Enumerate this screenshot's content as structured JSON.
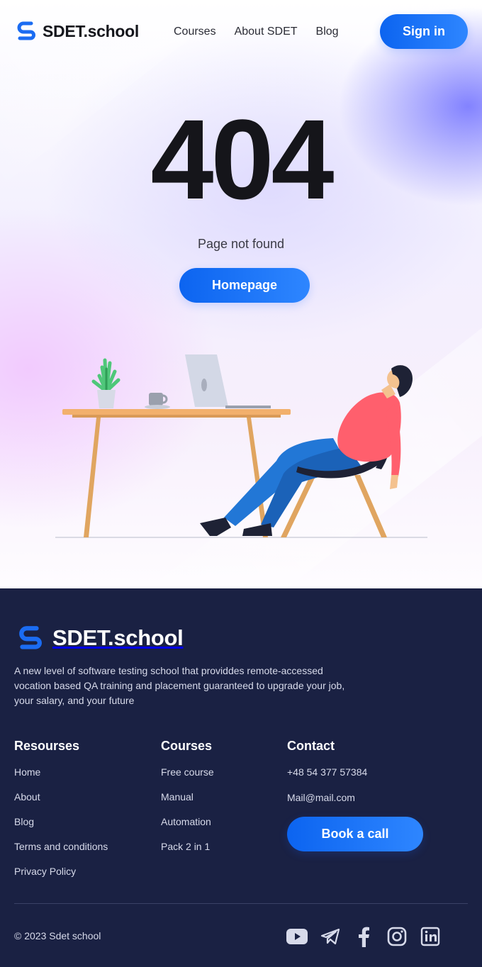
{
  "header": {
    "logo_text": "SDET.school",
    "nav": [
      "Courses",
      "About SDET",
      "Blog"
    ],
    "sign_in": "Sign in"
  },
  "hero": {
    "code": "404",
    "message": "Page not found",
    "button": "Homepage"
  },
  "footer": {
    "logo_text": "SDET.school",
    "description": "A new level of software testing school that providdes remote-accessed vocation based QA training and placement guaranteed to upgrade your job, your salary, and your future",
    "resources": {
      "title": "Resourses",
      "items": [
        "Home",
        "About",
        "Blog",
        "Terms and conditions",
        "Privacy Policy"
      ]
    },
    "courses": {
      "title": "Courses",
      "items": [
        "Free course",
        "Manual",
        "Automation",
        "Pack 2 in 1"
      ]
    },
    "contact": {
      "title": "Contact",
      "phone": "+48 54 377 57384",
      "email": "Mail@mail.com",
      "button": "Book a call"
    },
    "copyright": "© 2023 Sdet school",
    "socials": [
      "youtube-icon",
      "telegram-icon",
      "facebook-icon",
      "instagram-icon",
      "linkedin-icon"
    ]
  },
  "colors": {
    "accent": "#1a73ff",
    "footer_bg": "#1a2143"
  }
}
